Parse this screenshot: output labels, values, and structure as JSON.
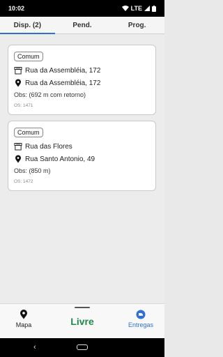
{
  "status_bar": {
    "time": "10:02",
    "network": "LTE"
  },
  "tabs": [
    {
      "label": "Disp. (2)",
      "active": true
    },
    {
      "label": "Pend.",
      "active": false
    },
    {
      "label": "Prog.",
      "active": false
    }
  ],
  "cards": [
    {
      "chip": "Comum",
      "origin": "Rua da Assembléia, 172",
      "destination": "Rua da Assembléia, 172",
      "obs": "Obs:  (692 m com retorno)",
      "os": "OS: 1471"
    },
    {
      "chip": "Comum",
      "origin": "Rua das Flores",
      "destination": "Rua Santo Antonio, 49",
      "obs": "Obs:  (850 m)",
      "os": "OS: 1472"
    }
  ],
  "bottom_nav": {
    "mapa_label": "Mapa",
    "status_label": "Livre",
    "entregas_label": "Entregas"
  },
  "system_nav": {
    "back_glyph": "‹"
  },
  "colors": {
    "accent": "#2f6fd6",
    "status_green": "#1f8a4a"
  }
}
